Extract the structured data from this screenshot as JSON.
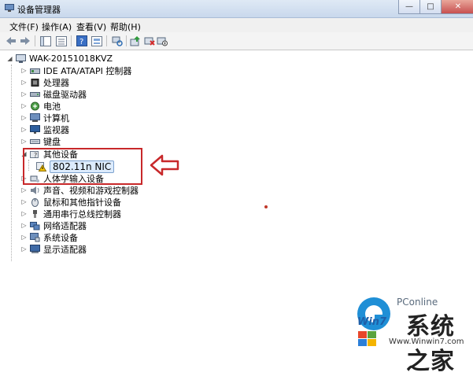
{
  "window": {
    "title": "设备管理器",
    "minimize": "—",
    "maximize": "□",
    "close": "✕"
  },
  "menu": {
    "items": [
      "文件(F)",
      "操作(A)",
      "查看(V)",
      "帮助(H)"
    ]
  },
  "tree": {
    "root": "WAK-20151018KVZ",
    "items": [
      {
        "label": "IDE ATA/ATAPI 控制器",
        "icon": "ide-controller-icon"
      },
      {
        "label": "处理器",
        "icon": "processor-icon"
      },
      {
        "label": "磁盘驱动器",
        "icon": "disk-drive-icon"
      },
      {
        "label": "电池",
        "icon": "battery-icon"
      },
      {
        "label": "计算机",
        "icon": "computer-icon"
      },
      {
        "label": "监视器",
        "icon": "monitor-icon"
      },
      {
        "label": "键盘",
        "icon": "keyboard-icon"
      },
      {
        "label": "其他设备",
        "icon": "other-devices-icon"
      },
      {
        "label": "802.11n NIC",
        "icon": "unknown-device-warning-icon"
      },
      {
        "label": "人体学输入设备",
        "icon": "hid-icon"
      },
      {
        "label": "声音、视频和游戏控制器",
        "icon": "sound-icon"
      },
      {
        "label": "鼠标和其他指针设备",
        "icon": "mouse-icon"
      },
      {
        "label": "通用串行总线控制器",
        "icon": "usb-icon"
      },
      {
        "label": "网络适配器",
        "icon": "network-adapter-icon"
      },
      {
        "label": "系统设备",
        "icon": "system-devices-icon"
      },
      {
        "label": "显示适配器",
        "icon": "display-adapter-icon"
      }
    ]
  },
  "watermark": {
    "brand": "PConline",
    "logo_text": "Win7",
    "big_text": "系统之家",
    "url": "Www.Winwin7.com"
  },
  "colors": {
    "highlight": "#c8282a",
    "selection": "#dcebfc"
  }
}
